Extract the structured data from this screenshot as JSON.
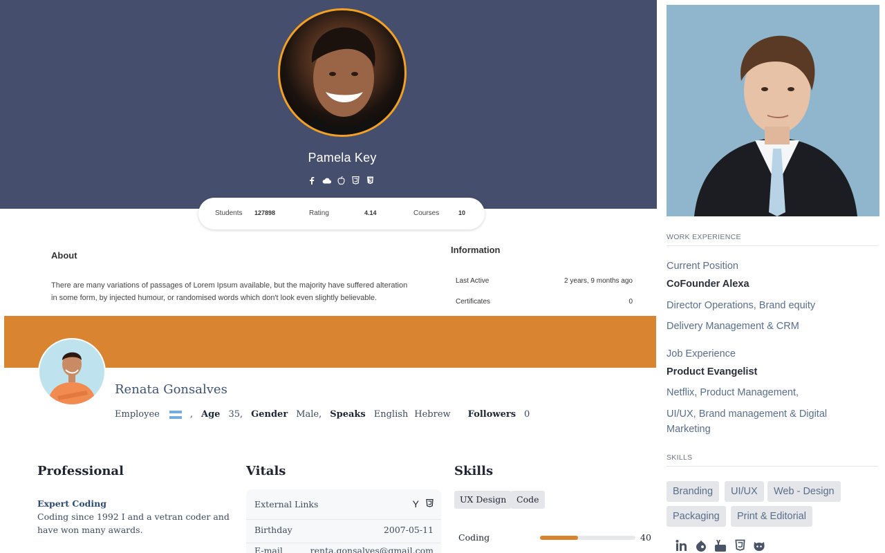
{
  "pamela": {
    "name": "Pamela Key",
    "social_icons": [
      "facebook-icon",
      "cloud-icon",
      "apple-icon",
      "html5-icon",
      "css3-icon"
    ],
    "stats": {
      "students_label": "Students",
      "students_value": "127898",
      "rating_label": "Rating",
      "rating_value": "4.14",
      "courses_label": "Courses",
      "courses_value": "10"
    },
    "about_title": "About",
    "about_text": "There are many variations of passages of Lorem Ipsum available, but the majority have suffered alteration in some form, by injected humour, or randomised words which don't look even slightly believable.",
    "info_title": "Information",
    "info": [
      {
        "label": "Last Active",
        "value": "2 years, 9 months ago"
      },
      {
        "label": "Certificates",
        "value": "0"
      }
    ]
  },
  "renata": {
    "name": "Renata Gonsalves",
    "role": "Employee",
    "comma": ",",
    "age_label": "Age",
    "age_value": "35,",
    "gender_label": "Gender",
    "gender_value": "Male,",
    "speaks_label": "Speaks",
    "languages": [
      "English",
      "Hebrew"
    ],
    "followers_label": "Followers",
    "followers_value": "0",
    "professional_title": "Professional",
    "professional_sub": "Expert Coding",
    "professional_text": "Coding since 1992 I and a vetran coder and have won many awards.",
    "vitals_title": "Vitals",
    "vitals": {
      "links_label": "External Links",
      "links_icons": [
        "y-combinator-icon",
        "html5-icon"
      ],
      "birthday_label": "Birthday",
      "birthday_value": "2007-05-11",
      "email_label": "E-mail",
      "email_value": "renta.gonsalves@gmail.com"
    },
    "skills_title": "Skills",
    "skill_tags": [
      "UX Design",
      "Code"
    ],
    "skill_bars": [
      {
        "label": "Coding",
        "value": 40
      }
    ],
    "colors": {
      "accent": "#d98431"
    }
  },
  "sidebar": {
    "work_heading": "WORK EXPERIENCE",
    "current_position_label": "Current Position",
    "current_company": "CoFounder Alexa",
    "current_line1": "Director Operations, Brand equity",
    "current_line2": "Delivery Management & CRM",
    "job_experience_label": "Job Experience",
    "job_title": "Product Evangelist",
    "job_line1": "Netflix, Product Management,",
    "job_line2": "UI/UX, Brand management & Digital Marketing",
    "skills_heading": "SKILLS",
    "skills": [
      "Branding",
      "UI/UX",
      "Web - Design",
      "Packaging",
      "Print & Editorial"
    ],
    "social_icons": [
      "linkedin-icon",
      "drupal-icon",
      "youtube-icon",
      "html5-icon",
      "github-icon"
    ]
  }
}
